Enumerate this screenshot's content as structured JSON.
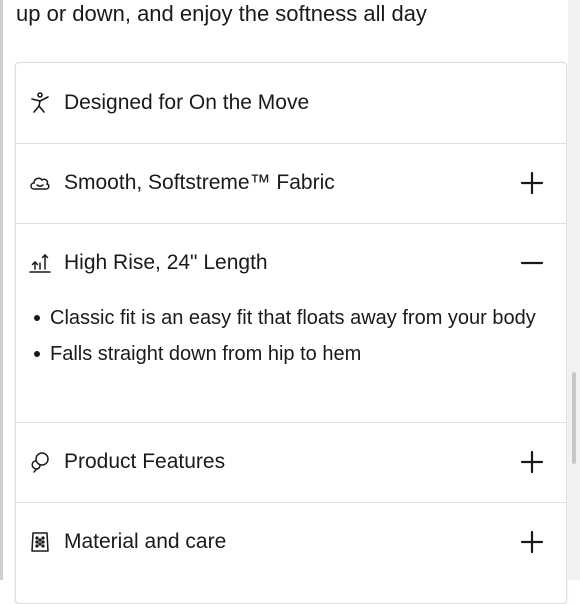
{
  "intro_text": "up or down, and enjoy the softness all day",
  "accordion": [
    {
      "title": "Designed for On the Move",
      "icon": "person-move-icon",
      "state": "none"
    },
    {
      "title": "Smooth, Softstreme™ Fabric",
      "icon": "cloud-face-icon",
      "state": "collapsed"
    },
    {
      "title": "High Rise, 24\" Length",
      "icon": "rise-length-icon",
      "state": "expanded",
      "bullets": [
        "Classic fit is an easy fit that floats away from your body",
        "Falls straight down from hip to hem"
      ]
    },
    {
      "title": "Product Features",
      "icon": "product-features-icon",
      "state": "collapsed"
    },
    {
      "title": "Material and care",
      "icon": "care-label-icon",
      "state": "collapsed"
    }
  ]
}
